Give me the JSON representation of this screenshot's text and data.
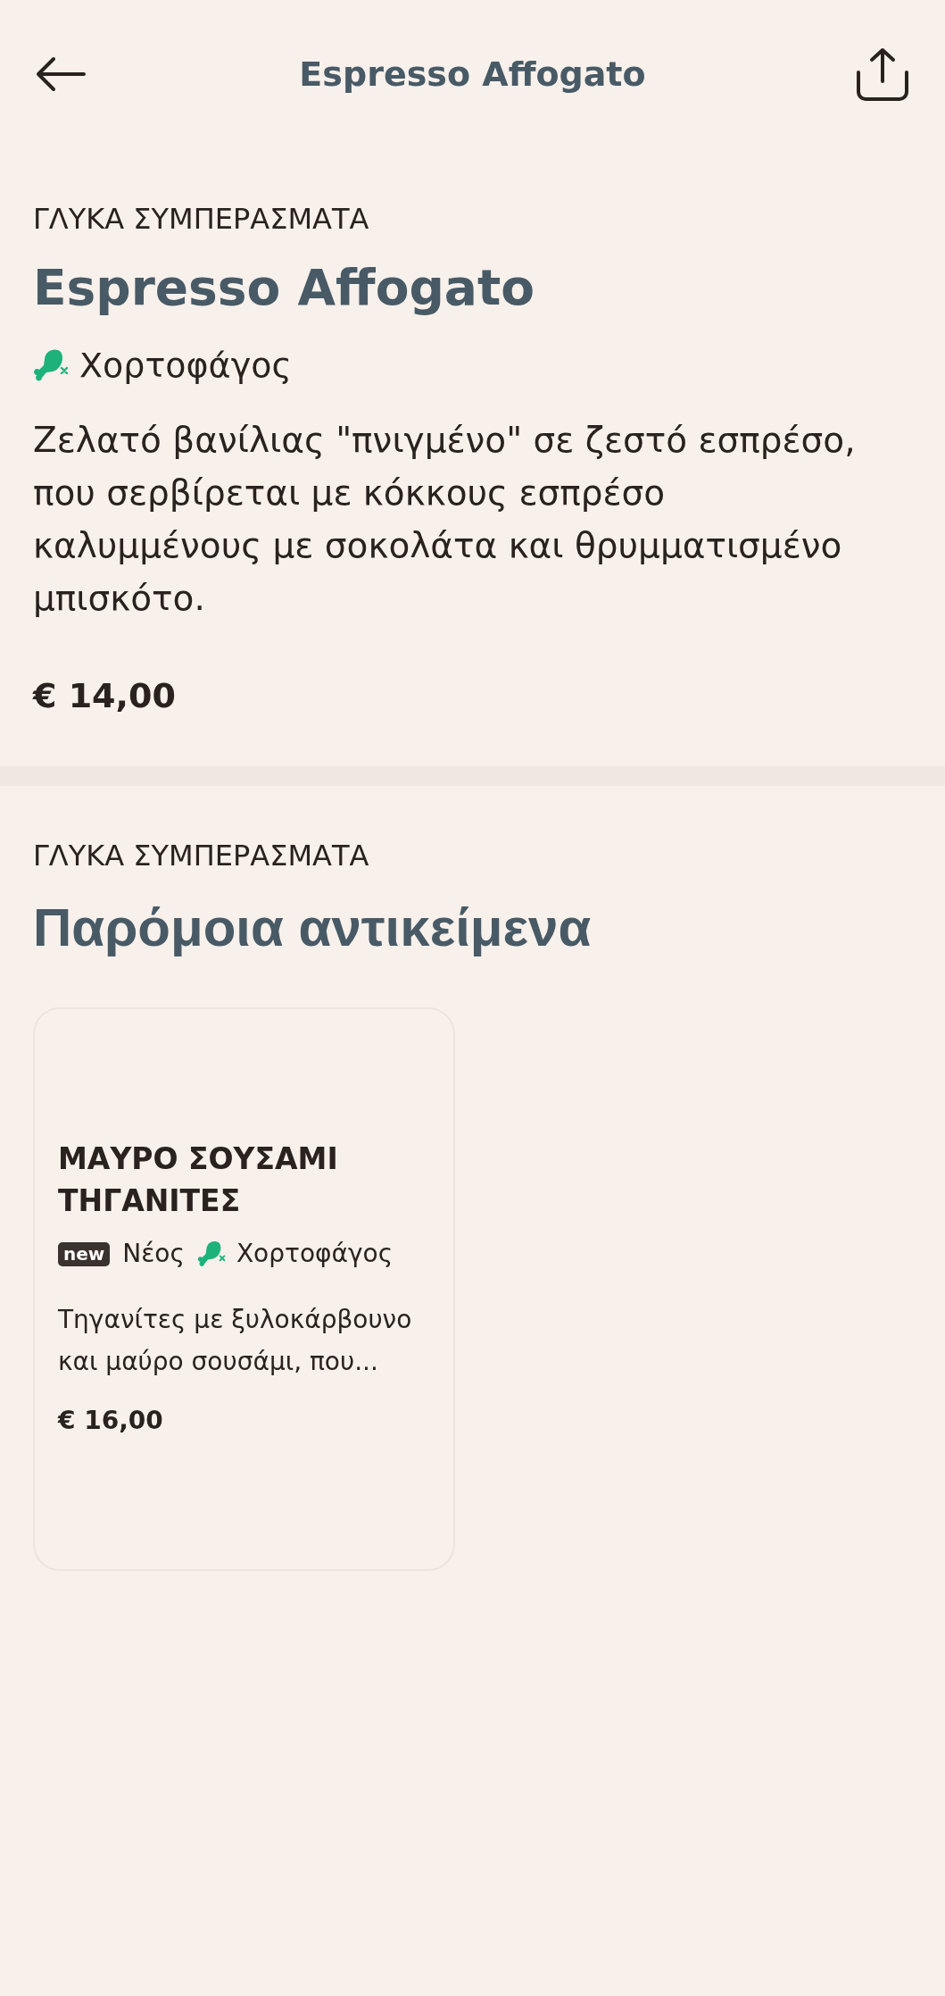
{
  "header": {
    "title": "Espresso Affogato"
  },
  "item": {
    "category": "ΓΛΥΚΑ ΣΥΜΠΕΡΑΣΜΑΤΑ",
    "name": "Espresso Affogato",
    "tags": [
      {
        "kind": "diet",
        "label": "Χορτοφάγος"
      }
    ],
    "description": "Ζελατό βανίλιας \"πνιγμένο\" σε ζεστό εσπρέσο, που σερβίρεται με κόκκους εσπρέσο καλυμμένους με σοκολάτα και θρυμματισμένο μπισκότο.",
    "price": "€ 14,00"
  },
  "similar": {
    "category": "ΓΛΥΚΑ ΣΥΜΠΕΡΑΣΜΑΤΑ",
    "title": "Παρόμοια αντικείμενα",
    "items": [
      {
        "name": "ΜΑΥΡΟ ΣΟΥΣΑΜΙ ΤΗΓΑΝΙΤΕΣ",
        "tags": [
          {
            "kind": "new",
            "badge": "new",
            "label": "Νέος"
          },
          {
            "kind": "diet",
            "label": "Χορτοφάγος"
          }
        ],
        "description": "Τηγανίτες με ξυλοκάρβουνο και μαύρο σουσάμι, που...",
        "price": "€ 16,00"
      }
    ]
  }
}
